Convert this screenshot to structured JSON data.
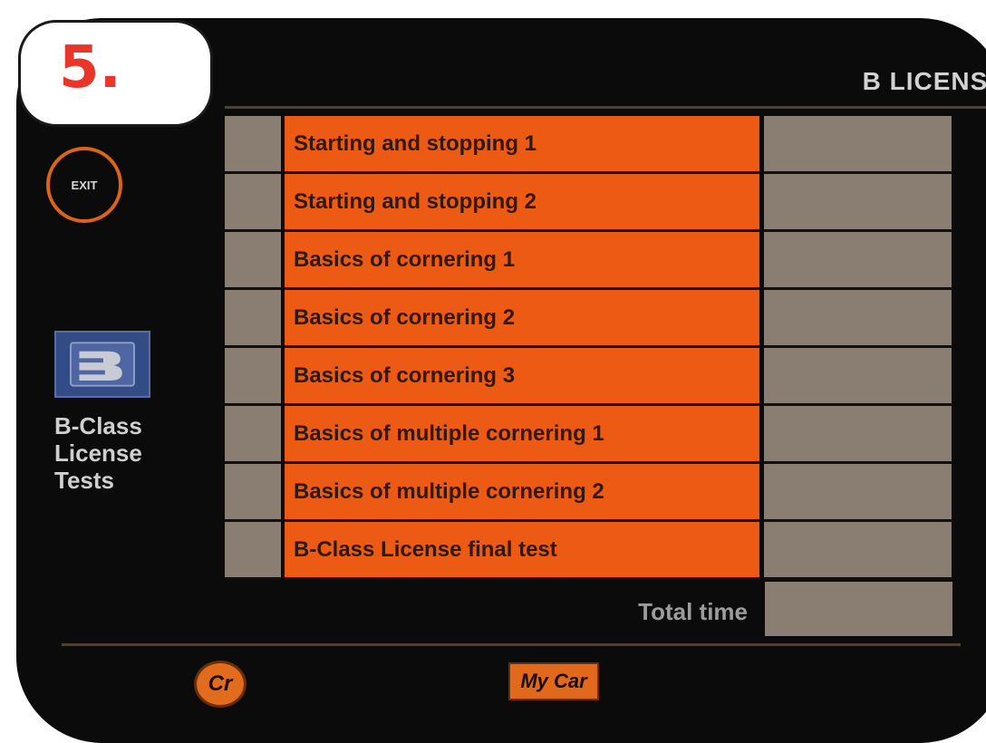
{
  "step_number": "5.",
  "header": {
    "title": "B LICENSE"
  },
  "exit_button": {
    "label": "EXIT"
  },
  "sidebar": {
    "label_lines": [
      "B-Class",
      "License",
      "Tests"
    ]
  },
  "tests": [
    {
      "name": "Starting and stopping 1",
      "status": "",
      "time": ""
    },
    {
      "name": "Starting and stopping 2",
      "status": "",
      "time": ""
    },
    {
      "name": "Basics of cornering 1",
      "status": "",
      "time": ""
    },
    {
      "name": "Basics of cornering 2",
      "status": "",
      "time": ""
    },
    {
      "name": "Basics of cornering 3",
      "status": "",
      "time": ""
    },
    {
      "name": "Basics of multiple cornering 1",
      "status": "",
      "time": ""
    },
    {
      "name": "Basics of multiple cornering 2",
      "status": "",
      "time": ""
    },
    {
      "name": "B-Class License final test",
      "status": "",
      "time": ""
    }
  ],
  "total": {
    "label": "Total time",
    "value": ""
  },
  "footer": {
    "cr_label": "Cr",
    "mycar_label": "My Car"
  },
  "colors": {
    "accent": "#ec5a14",
    "cell_grey": "#8a7e72",
    "background": "#0b0b0b",
    "badge_number": "#e8372a"
  }
}
